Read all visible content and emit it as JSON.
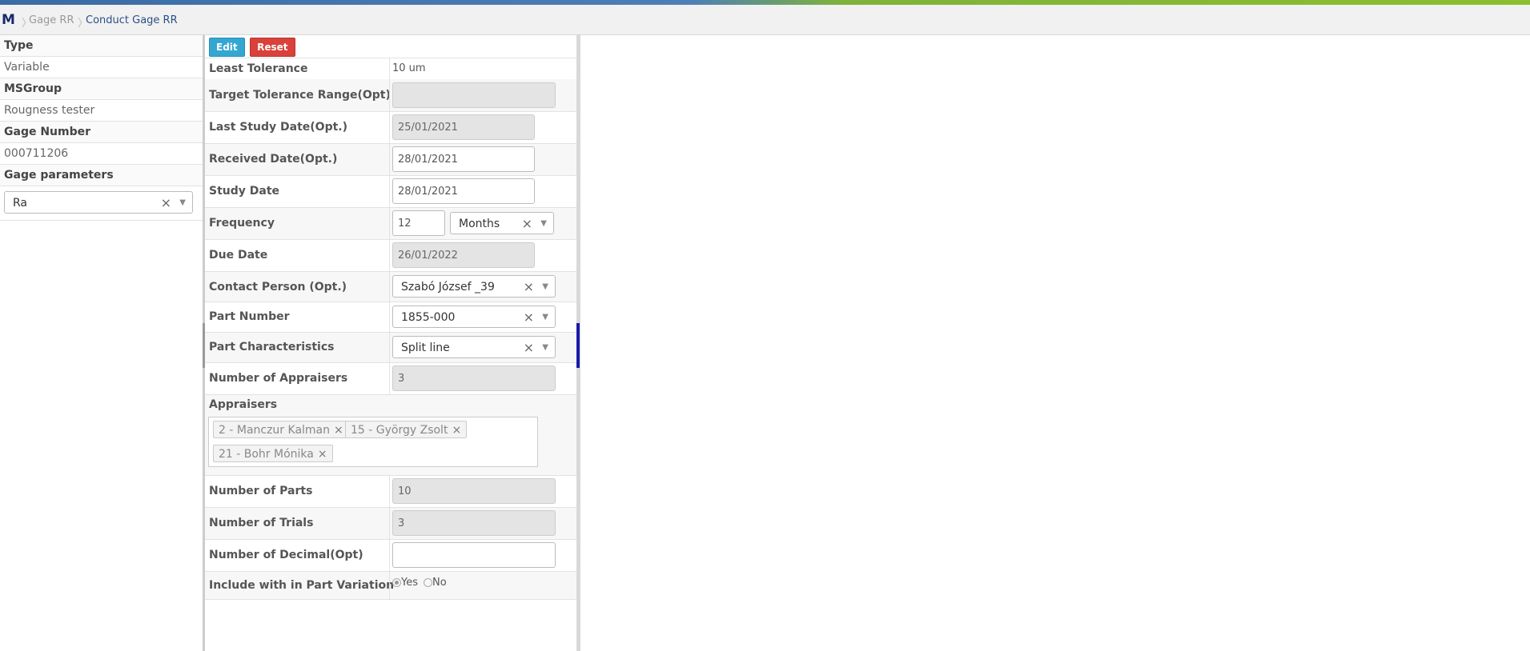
{
  "header": {
    "logo": "M",
    "breadcrumb": [
      "Gage RR",
      "Conduct Gage RR"
    ]
  },
  "left": {
    "type_label": "Type",
    "type_value": "Variable",
    "msgroup_label": "MSGroup",
    "msgroup_value": "Rougness tester",
    "gage_number_label": "Gage Number",
    "gage_number_value": "000711206",
    "gage_params_label": "Gage parameters",
    "gage_params_value": "Ra"
  },
  "toolbar": {
    "edit_label": "Edit",
    "reset_label": "Reset"
  },
  "form": {
    "least_tolerance_label": "Least Tolerance",
    "least_tolerance_value": "10 um",
    "target_tolerance_label": "Target Tolerance Range(Opt)",
    "target_tolerance_value": "",
    "last_study_label": "Last Study Date(Opt.)",
    "last_study_value": "25/01/2021",
    "received_label": "Received Date(Opt.)",
    "received_value": "28/01/2021",
    "study_date_label": "Study Date",
    "study_date_value": "28/01/2021",
    "frequency_label": "Frequency",
    "frequency_value": "12",
    "frequency_unit": "Months",
    "due_date_label": "Due Date",
    "due_date_value": "26/01/2022",
    "contact_label": "Contact Person (Opt.)",
    "contact_value": "Szabó József _39",
    "part_number_label": "Part Number",
    "part_number_value": "1855-000",
    "part_char_label": "Part Characteristics",
    "part_char_value": "Split line",
    "num_appraisers_label": "Number of Appraisers",
    "num_appraisers_value": "3",
    "appraisers_label": "Appraisers",
    "appraisers": [
      "2 - Manczur Kalman",
      "15 - György Zsolt",
      "21 - Bohr Mónika"
    ],
    "num_parts_label": "Number of Parts",
    "num_parts_value": "10",
    "num_trials_label": "Number of Trials",
    "num_trials_value": "3",
    "num_decimal_label": "Number of Decimal(Opt)",
    "num_decimal_value": "",
    "include_label": "Include with in Part Variation",
    "include_yes": "Yes",
    "include_no": "No"
  },
  "icons": {
    "clear": "×",
    "dropdown": "▼",
    "remove": "×"
  }
}
